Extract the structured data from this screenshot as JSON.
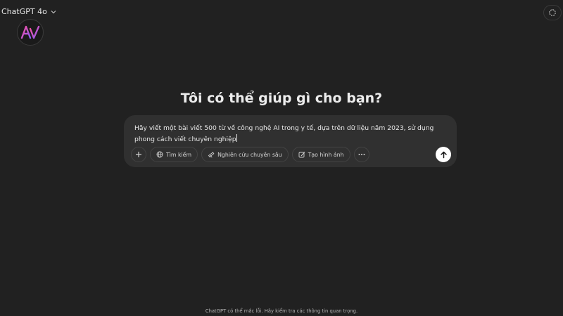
{
  "model_selector": {
    "label": "ChatGPT 4o",
    "icon": "chevron-down-icon"
  },
  "logo": {
    "icon": "av-logo-icon",
    "colors": [
      "#ff4fa0",
      "#8b5cf6"
    ]
  },
  "top_right": {
    "icon": "temporary-chat-icon"
  },
  "headline": "Tôi có thể giúp gì cho bạn?",
  "composer": {
    "text": "Hãy viết một bài viết 500 từ về công nghệ AI trong y tế, dựa trên dữ liệu năm 2023, sử dụng phong cách viết chuyên nghiệp",
    "tools": [
      {
        "label": "Tìm kiếm",
        "icon": "globe-icon"
      },
      {
        "label": "Nghiên cứu chuyên sâu",
        "icon": "telescope-icon"
      },
      {
        "label": "Tạo hình ảnh",
        "icon": "image-brush-icon"
      }
    ],
    "add_icon": "plus-icon",
    "more_icon": "ellipsis-icon",
    "send_icon": "arrow-up-icon"
  },
  "footer": "ChatGPT có thể mắc lỗi. Hãy kiểm tra các thông tin quan trọng."
}
